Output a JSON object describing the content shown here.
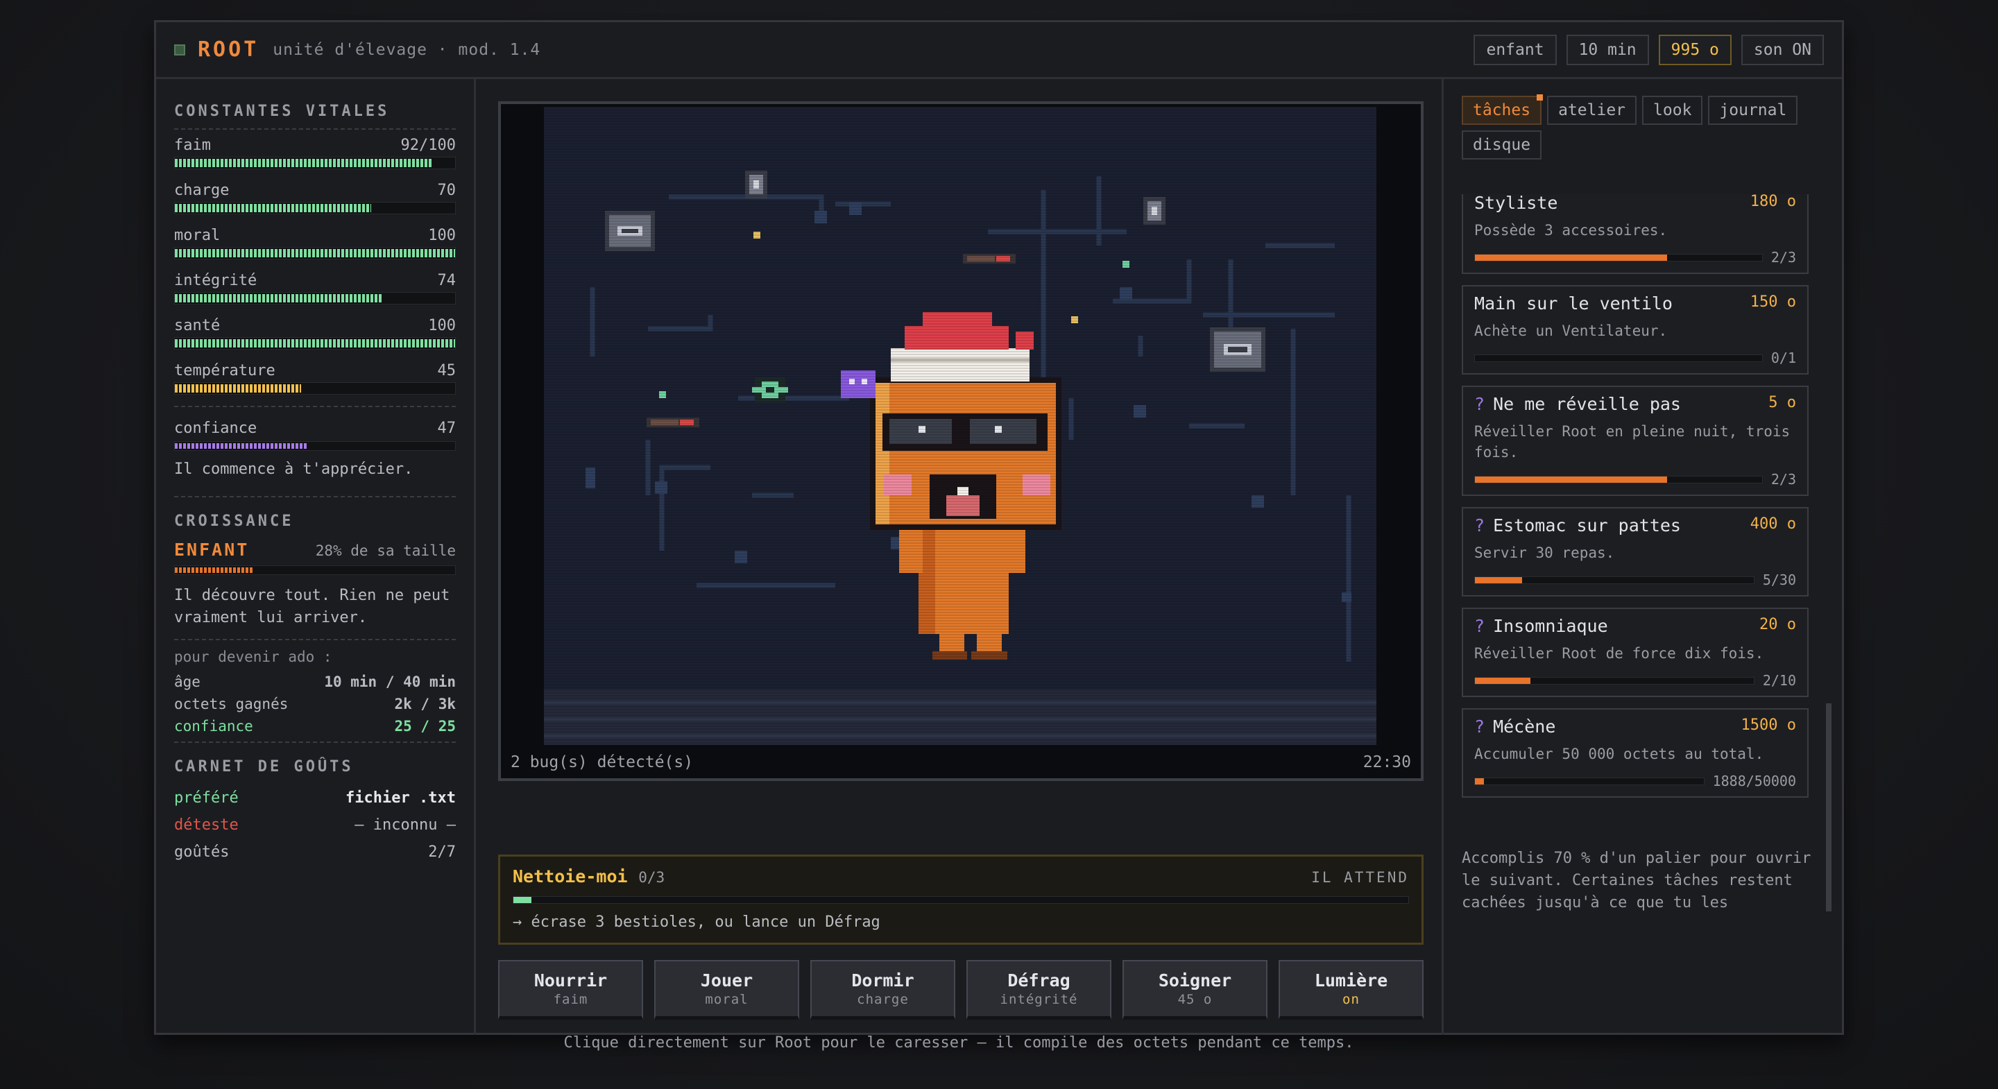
{
  "header": {
    "title": "ROOT",
    "subtitle": "unité d'élevage · mod. 1.4",
    "chips": [
      "enfant",
      "10 min",
      "995 o",
      "son ON"
    ]
  },
  "vitals": {
    "title": "CONSTANTES VITALES",
    "stats": [
      {
        "label": "faim",
        "value": "92/100",
        "level": 92,
        "color": "#7ee0a0"
      },
      {
        "label": "charge",
        "value": "70",
        "level": 70,
        "color": "#7ee0a0"
      },
      {
        "label": "moral",
        "value": "100",
        "level": 100,
        "color": "#7ee0a0"
      },
      {
        "label": "intégrité",
        "value": "74",
        "level": 74,
        "color": "#7ee0a0"
      },
      {
        "label": "santé",
        "value": "100",
        "level": 100,
        "color": "#7ee0a0"
      },
      {
        "label": "température",
        "value": "45",
        "level": 45,
        "color": "#f3c04a"
      }
    ],
    "trust": {
      "label": "confiance",
      "value": "47",
      "level": 47,
      "color": "#a77be8",
      "note": "Il commence à t'apprécier."
    }
  },
  "growth": {
    "title": "CROISSANCE",
    "stage": "ENFANT",
    "size": "28% de sa taille",
    "level": 28,
    "desc": "Il découvre tout. Rien ne peut vraiment lui arriver.",
    "next_label": "pour devenir ado :",
    "reqs": [
      {
        "label": "âge",
        "value": "10 min / 40 min"
      },
      {
        "label": "octets gagnés",
        "value": "2k / 3k"
      },
      {
        "label": "confiance",
        "value": "25 / 25"
      }
    ]
  },
  "tastes": {
    "title": "CARNET DE GOÛTS",
    "liked_label": "préféré",
    "liked": "fichier .txt",
    "hated_label": "déteste",
    "hated": "— inconnu —",
    "count_label": "goûtés",
    "count": "2/7"
  },
  "screen": {
    "bugs": "2 bug(s) détecté(s)",
    "time": "22:30"
  },
  "quest": {
    "title": "Nettoie-moi",
    "progress": "0/3",
    "status": "IL ATTEND",
    "hint": "→ écrase 3 bestioles, ou lance un Défrag",
    "level": 2
  },
  "actions": [
    {
      "label": "Nourrir",
      "sub": "faim"
    },
    {
      "label": "Jouer",
      "sub": "moral"
    },
    {
      "label": "Dormir",
      "sub": "charge"
    },
    {
      "label": "Défrag",
      "sub": "intégrité"
    },
    {
      "label": "Soigner",
      "sub": "45 o"
    },
    {
      "label": "Lumière",
      "sub": "on"
    }
  ],
  "hint": "Clique directement sur Root pour le caresser — il compile des octets pendant ce temps.",
  "tabs": [
    "tâches",
    "atelier",
    "look",
    "journal",
    "disque"
  ],
  "tasks": [
    {
      "hidden": false,
      "title": "Styliste",
      "price": "180 o",
      "desc": "Possède 3 accessoires.",
      "progress": "2/3",
      "level": 67
    },
    {
      "hidden": false,
      "title": "Main sur le ventilo",
      "price": "150 o",
      "desc": "Achète un Ventilateur.",
      "progress": "0/1",
      "level": 0
    },
    {
      "hidden": true,
      "title": "Ne me réveille pas",
      "price": "5 o",
      "desc": "Réveiller Root en pleine nuit, trois fois.",
      "progress": "2/3",
      "level": 67
    },
    {
      "hidden": true,
      "title": "Estomac sur pattes",
      "price": "400 o",
      "desc": "Servir 30 repas.",
      "progress": "5/30",
      "level": 17
    },
    {
      "hidden": true,
      "title": "Insomniaque",
      "price": "20 o",
      "desc": "Réveiller Root de force dix fois.",
      "progress": "2/10",
      "level": 20
    },
    {
      "hidden": true,
      "title": "Mécène",
      "price": "1500 o",
      "desc": "Accumuler 50 000 octets au total.",
      "progress": "1888/50000",
      "level": 4
    }
  ],
  "tasks_note": "Accomplis 70 % d'un palier pour ouvrir le suivant. Certaines tâches restent cachées jusqu'à ce que tu les",
  "colors": {
    "accent": "#f08a3c",
    "gold": "#f3c04a",
    "green": "#7ee0a0",
    "purple": "#a77be8"
  }
}
